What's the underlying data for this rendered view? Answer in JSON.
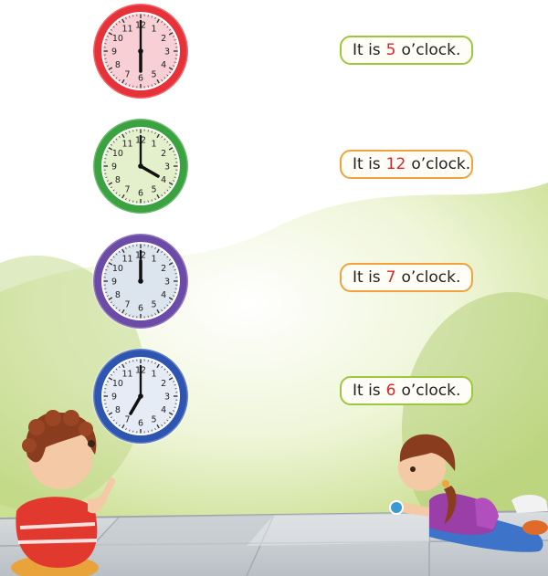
{
  "colors": {
    "label_border_green": "#9cc83b",
    "label_border_orange": "#f1a23a",
    "number_red": "#d8262d"
  },
  "dial_numbers": [
    "12",
    "1",
    "2",
    "3",
    "4",
    "5",
    "6",
    "7",
    "8",
    "9",
    "10",
    "11"
  ],
  "clocks": [
    {
      "rim_color": "#e8323a",
      "face_color": "#f7cfd5",
      "hour": 6,
      "minute": 0
    },
    {
      "rim_color": "#3aa23f",
      "face_color": "#e4efcc",
      "hour": 4,
      "minute": 0
    },
    {
      "rim_color": "#6b4aa8",
      "face_color": "#dce5ee",
      "hour": 12,
      "minute": 0
    },
    {
      "rim_color": "#2f55b3",
      "face_color": "#e6ecf6",
      "hour": 7,
      "minute": 0
    }
  ],
  "labels": [
    {
      "prefix": "It is",
      "number": "5",
      "suffix": "o’clock.",
      "border": "#9cc83b"
    },
    {
      "prefix": "It is",
      "number": "12",
      "suffix": "o’clock.",
      "border": "#f1a23a"
    },
    {
      "prefix": "It is",
      "number": "7",
      "suffix": "o’clock.",
      "border": "#f1a23a"
    },
    {
      "prefix": "It is",
      "number": "6",
      "suffix": "o’clock.",
      "border": "#9cc83b"
    }
  ]
}
